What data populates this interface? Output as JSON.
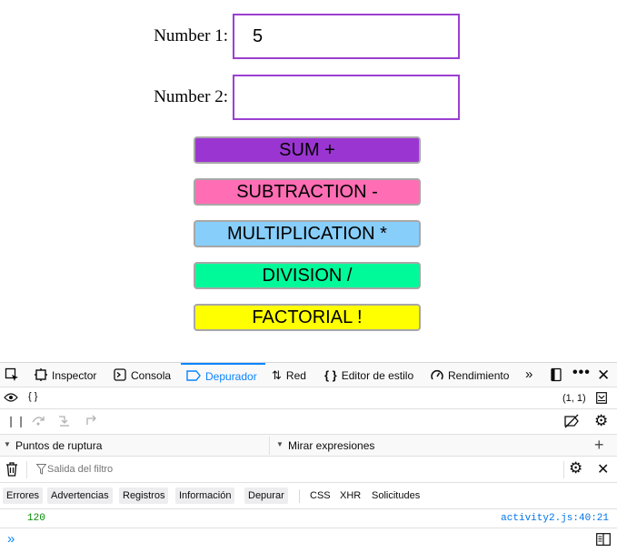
{
  "form": {
    "number1_label": "Number 1:",
    "number1_value": "5",
    "number2_label": "Number 2:",
    "number2_value": ""
  },
  "buttons": {
    "sum": "SUM +",
    "subtraction": "SUBTRACTION -",
    "multiplication": "MULTIPLICATION *",
    "division": "DIVISION /",
    "factorial": "FACTORIAL !"
  },
  "colors": {
    "sum": "#9b35d2",
    "subtraction": "#ff6eb4",
    "multiplication": "#87cefa",
    "division": "#00fa9a",
    "factorial": "#ffff00",
    "input_border": "#9b3fd0",
    "accent": "#0a84ff"
  },
  "devtools": {
    "tabs": {
      "inspector": "Inspector",
      "console": "Consola",
      "debugger": "Depurador",
      "network": "Red",
      "style_editor": "Editor de estilo",
      "performance": "Rendimiento"
    },
    "source_braces": "{ }",
    "cursor_position": "(1, 1)",
    "breakpoints_label": "Puntos de ruptura",
    "watch_label": "Mirar expresiones",
    "filter_placeholder": "Salida del filtro",
    "filters": {
      "errors": "Errores",
      "warnings": "Advertencias",
      "logs": "Registros",
      "info": "Información",
      "debug": "Depurar",
      "css": "CSS",
      "xhr": "XHR",
      "requests": "Solicitudes"
    },
    "console_output": {
      "value": "120",
      "source": "activity2.js:40:21"
    },
    "prompt": "»"
  }
}
